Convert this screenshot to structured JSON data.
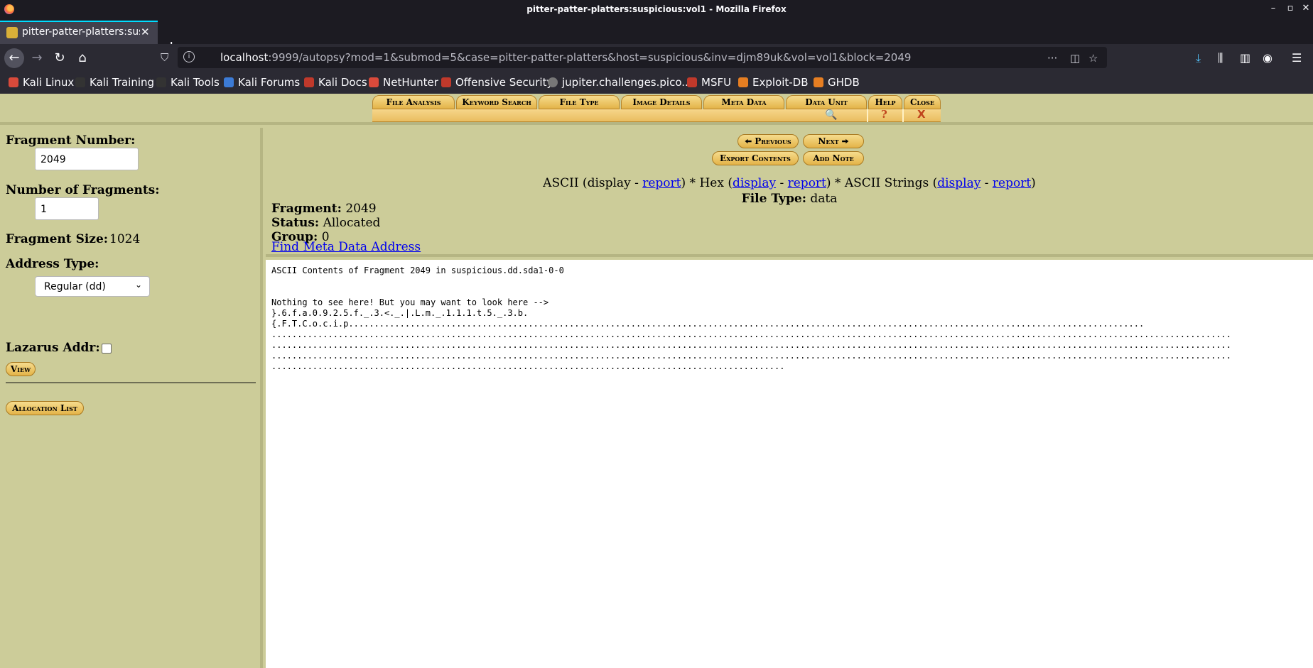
{
  "window": {
    "title": "pitter-patter-platters:suspicious:vol1 - Mozilla Firefox",
    "controls": [
      "–",
      "▫",
      "✕"
    ]
  },
  "tab": {
    "title": "pitter-patter-platters:sus",
    "close": "✕",
    "new": "+"
  },
  "nav": {
    "back": "←",
    "forward": "→",
    "reload": "↻",
    "home": "⌂",
    "url_host": "localhost",
    "url_rest": ":9999/autopsy?mod=1&submod=5&case=pitter-patter-platters&host=suspicious&inv=djm89uk&vol=vol1&block=2049",
    "page_actions": "···"
  },
  "bookmarks": [
    {
      "label": "Kali Linux",
      "color": "#d94a3b"
    },
    {
      "label": "Kali Training",
      "color": "#333333"
    },
    {
      "label": "Kali Tools",
      "color": "#333333"
    },
    {
      "label": "Kali Forums",
      "color": "#3c7bd6"
    },
    {
      "label": "Kali Docs",
      "color": "#c0392b"
    },
    {
      "label": "NetHunter",
      "color": "#d94a3b"
    },
    {
      "label": "Offensive Security",
      "color": "#c0392b"
    },
    {
      "label": "jupiter.challenges.pico...",
      "color": "#777777"
    },
    {
      "label": "MSFU",
      "color": "#c0392b"
    },
    {
      "label": "Exploit-DB",
      "color": "#e67e22"
    },
    {
      "label": "GHDB",
      "color": "#e67e22"
    }
  ],
  "menu": {
    "tabs": [
      "File Analysis",
      "Keyword Search",
      "File Type",
      "Image Details",
      "Meta Data",
      "Data Unit",
      "Help",
      "Close"
    ],
    "help_glyph": "?",
    "close_glyph": "X"
  },
  "left": {
    "fragment_number_label": "Fragment Number:",
    "fragment_number_value": "2049",
    "num_fragments_label": "Number of Fragments:",
    "num_fragments_value": "1",
    "fragment_size_label": "Fragment Size:",
    "fragment_size_value": "1024",
    "address_type_label": "Address Type:",
    "address_type_value": "Regular (dd)",
    "lazarus_label": "Lazarus Addr:",
    "view_button": "View",
    "allocation_list_button": "Allocation List"
  },
  "right": {
    "previous_button": "Previous",
    "next_button": "Next",
    "export_button": "Export Contents",
    "add_note_button": "Add Note",
    "links": {
      "ascii_prefix": "ASCII (display - ",
      "ascii_report": "report",
      "hex_prefix": ") * Hex (",
      "hex_display": "display",
      "sep1": " - ",
      "hex_report": "report",
      "strings_prefix": ") * ASCII Strings (",
      "strings_display": "display",
      "sep2": " - ",
      "strings_report": "report",
      "close": ")"
    },
    "file_type_label": "File Type:",
    "file_type_value": "data",
    "fragment_label": "Fragment:",
    "fragment_value": "2049",
    "status_label": "Status:",
    "status_value": "Allocated",
    "group_label": "Group:",
    "group_value": "0",
    "find_meta_link": "Find Meta Data Address"
  },
  "content": {
    "heading": "ASCII Contents of Fragment 2049 in suspicious.dd.sda1-0-0",
    "line1": "Nothing to see here! But you may want to look here -->",
    "line2": "}.6.f.a.0.9.2.5.f._.3.<._.|.L.m._.1.1.1.t.5._.3.b.",
    "line3": "{.F.T.C.o.c.i.p...........................................................................................................................................................",
    "line4": "...........................................................................................................................................................................................",
    "line5": "...........................................................................................................................................................................................",
    "line6": "...........................................................................................................................................................................................",
    "line7": "...................................................................................................."
  }
}
